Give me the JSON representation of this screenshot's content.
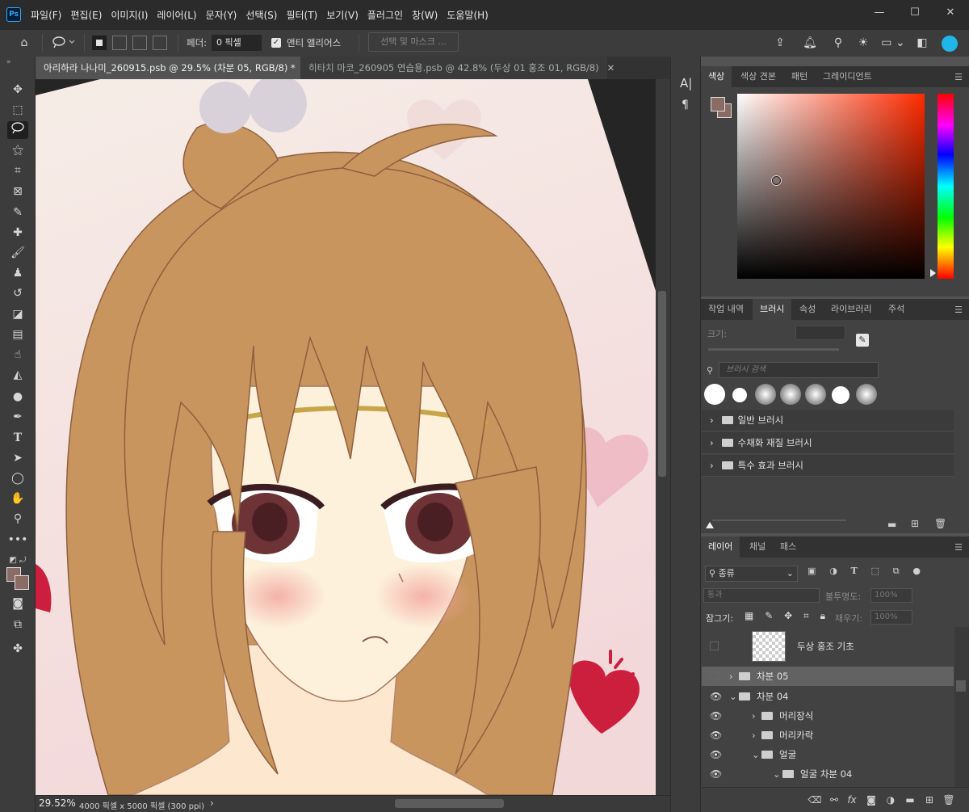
{
  "app": {
    "name": "Photoshop",
    "logo": "Ps"
  },
  "menu": [
    "파일(F)",
    "편집(E)",
    "이미지(I)",
    "레이어(L)",
    "문자(Y)",
    "선택(S)",
    "필터(T)",
    "보기(V)",
    "플러그인",
    "창(W)",
    "도움말(H)"
  ],
  "window_controls": {
    "minimize": "—",
    "maximize": "☐",
    "close": "✕"
  },
  "options": {
    "feather_label": "페더:",
    "feather_value": "0 픽셀",
    "antialias_label": "앤티 앨리어스",
    "antialias_checked": true,
    "select_mask_label": "선택 및 마스크 ..."
  },
  "tabs": [
    {
      "label": "아리하라 나나미_260915.psb @ 29.5% (차분 05, RGB/8) *",
      "close": "✕"
    },
    {
      "label": "히타치 마코_260905 연습용.psb @ 42.8% (두상 01 홍조 01, RGB/8)",
      "close": "✕"
    }
  ],
  "status": {
    "zoom": "29.52%",
    "doc_info": "4000 픽셀 x 5000 픽셀 (300 ppi)",
    "arrow": "›"
  },
  "color_panel": {
    "tabs": [
      "색상",
      "색상 견본",
      "패턴",
      "그레이디언트"
    ],
    "active_tab": 0,
    "foreground": "#8a6c64",
    "hue_color": "#ff2a00"
  },
  "brush_panel": {
    "tabs": [
      "작업 내역",
      "브러시",
      "속성",
      "라이브러리",
      "주석"
    ],
    "active_tab": 1,
    "size_label": "크기:",
    "search_placeholder": "브러시 검색",
    "folders": [
      "일반 브러시",
      "수채화 재질 브러시",
      "특수 효과 브러시"
    ]
  },
  "layers_panel": {
    "tabs": [
      "레이어",
      "채널",
      "패스"
    ],
    "active_tab": 0,
    "filter_label": "종류",
    "blend_mode": "통과",
    "opacity_label": "불투명도:",
    "opacity_value": "100%",
    "lock_label": "잠그기:",
    "fill_label": "채우기:",
    "fill_value": "100%",
    "layers": [
      {
        "name": "두상 홍조 기초",
        "visible": false,
        "type": "pixel",
        "indent": 0
      },
      {
        "name": "차분 05",
        "visible": false,
        "type": "group",
        "expanded": false,
        "selected": true,
        "indent": 0
      },
      {
        "name": "차분 04",
        "visible": true,
        "type": "group",
        "expanded": true,
        "indent": 0
      },
      {
        "name": "머리장식",
        "visible": true,
        "type": "group",
        "expanded": false,
        "indent": 1
      },
      {
        "name": "머리카락",
        "visible": true,
        "type": "group",
        "expanded": false,
        "indent": 1
      },
      {
        "name": "얼굴",
        "visible": true,
        "type": "group",
        "expanded": true,
        "indent": 1
      },
      {
        "name": "얼굴 차분 04",
        "visible": true,
        "type": "group",
        "expanded": true,
        "indent": 2
      }
    ]
  },
  "colors": {
    "accent": "#31a8ff",
    "heart": "#cc1f3e",
    "hair": "#c8955f",
    "skin": "#fdebd6"
  }
}
